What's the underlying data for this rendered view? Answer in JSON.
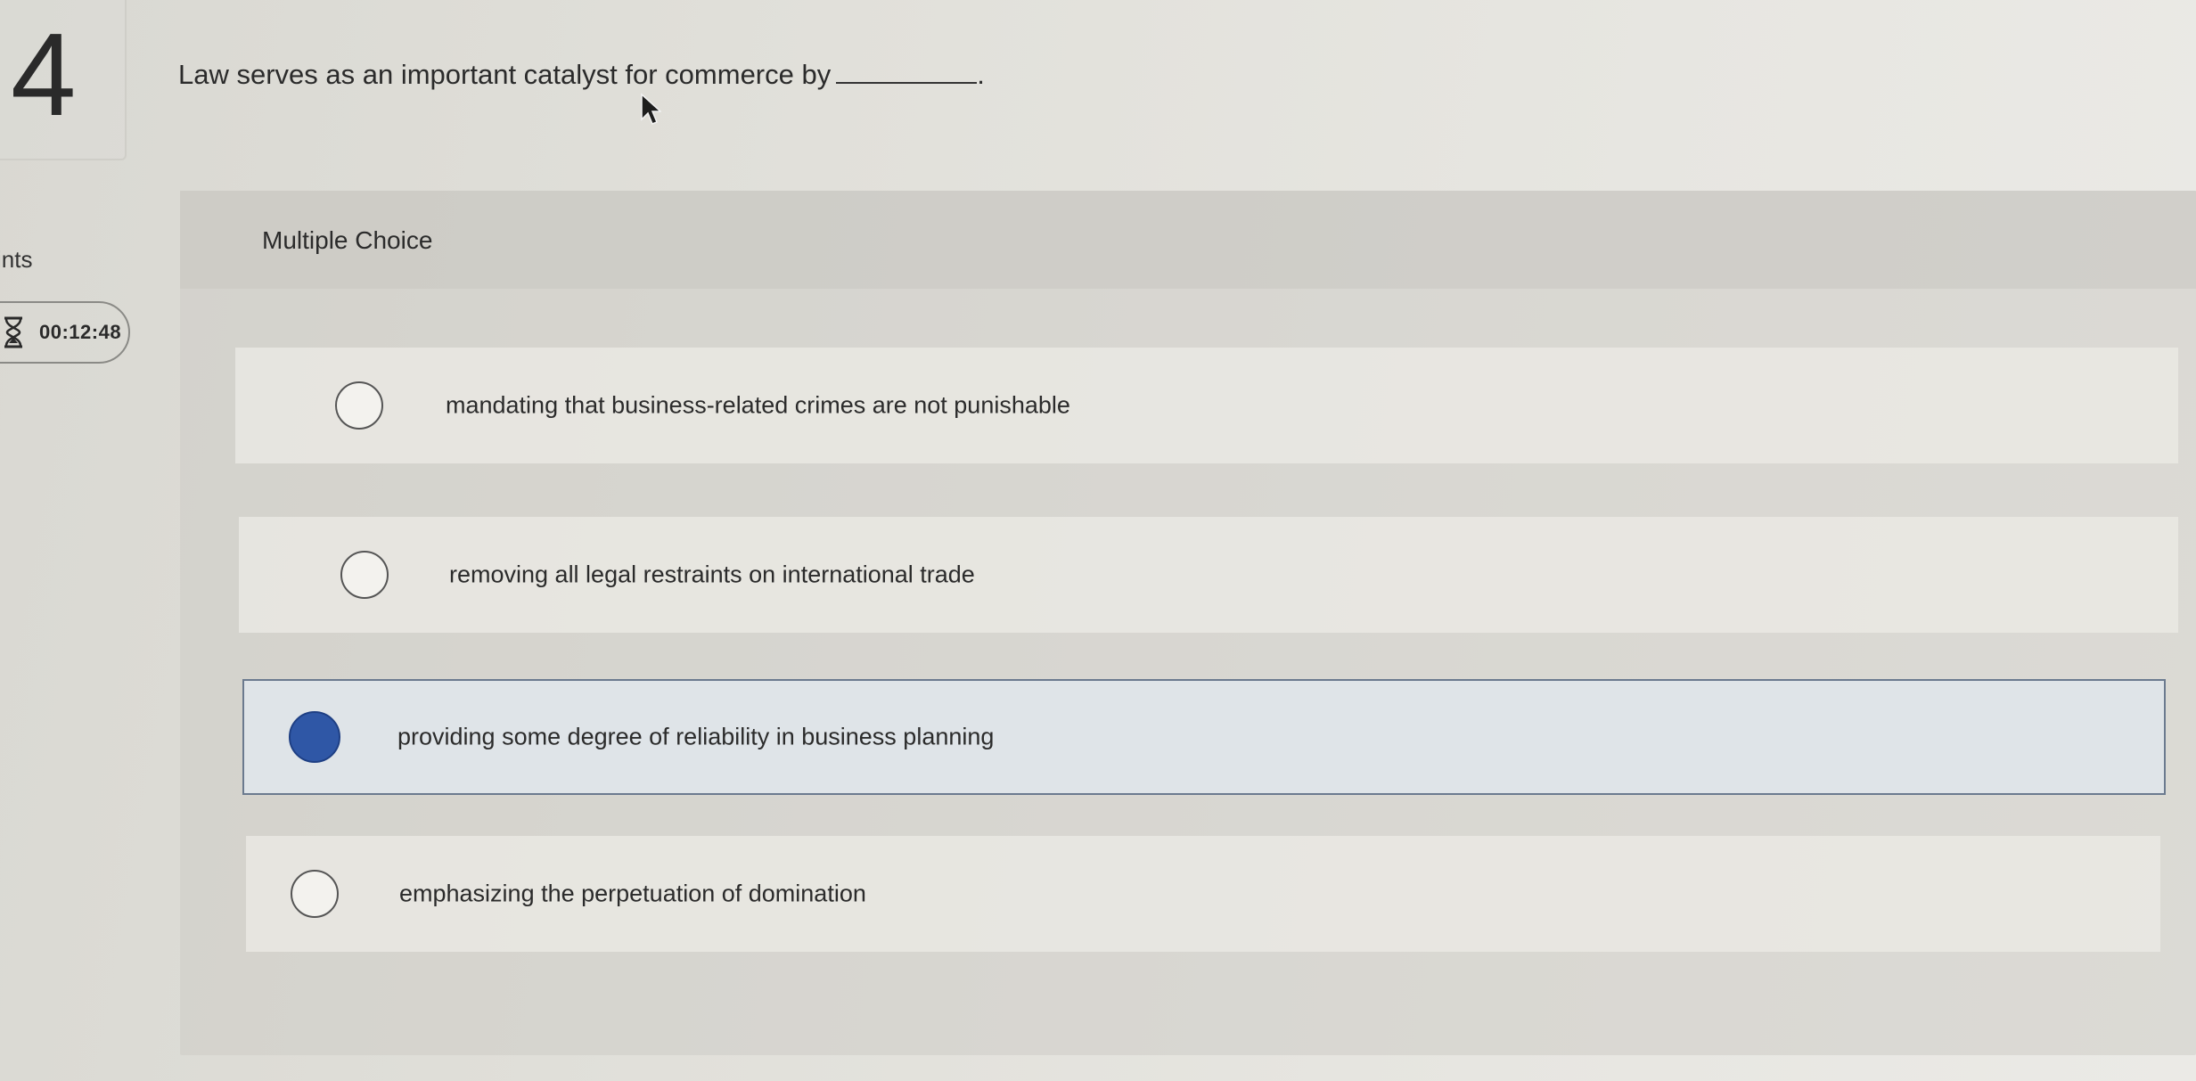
{
  "question": {
    "number": "4",
    "text": "Law serves as an important catalyst for commerce by",
    "end_punct": "."
  },
  "meta": {
    "points_label": "ints",
    "timer": "00:12:48"
  },
  "panel": {
    "title": "Multiple Choice"
  },
  "choices": [
    {
      "label": "mandating that business-related crimes are not punishable",
      "selected": false
    },
    {
      "label": "removing all legal restraints on international trade",
      "selected": false
    },
    {
      "label": "providing some degree of reliability in business planning",
      "selected": true
    },
    {
      "label": "emphasizing the perpetuation of domination",
      "selected": false
    }
  ],
  "colors": {
    "selected_radio": "#2f57a6",
    "selected_border": "#6b7a8f",
    "background": "#e1e0da"
  }
}
